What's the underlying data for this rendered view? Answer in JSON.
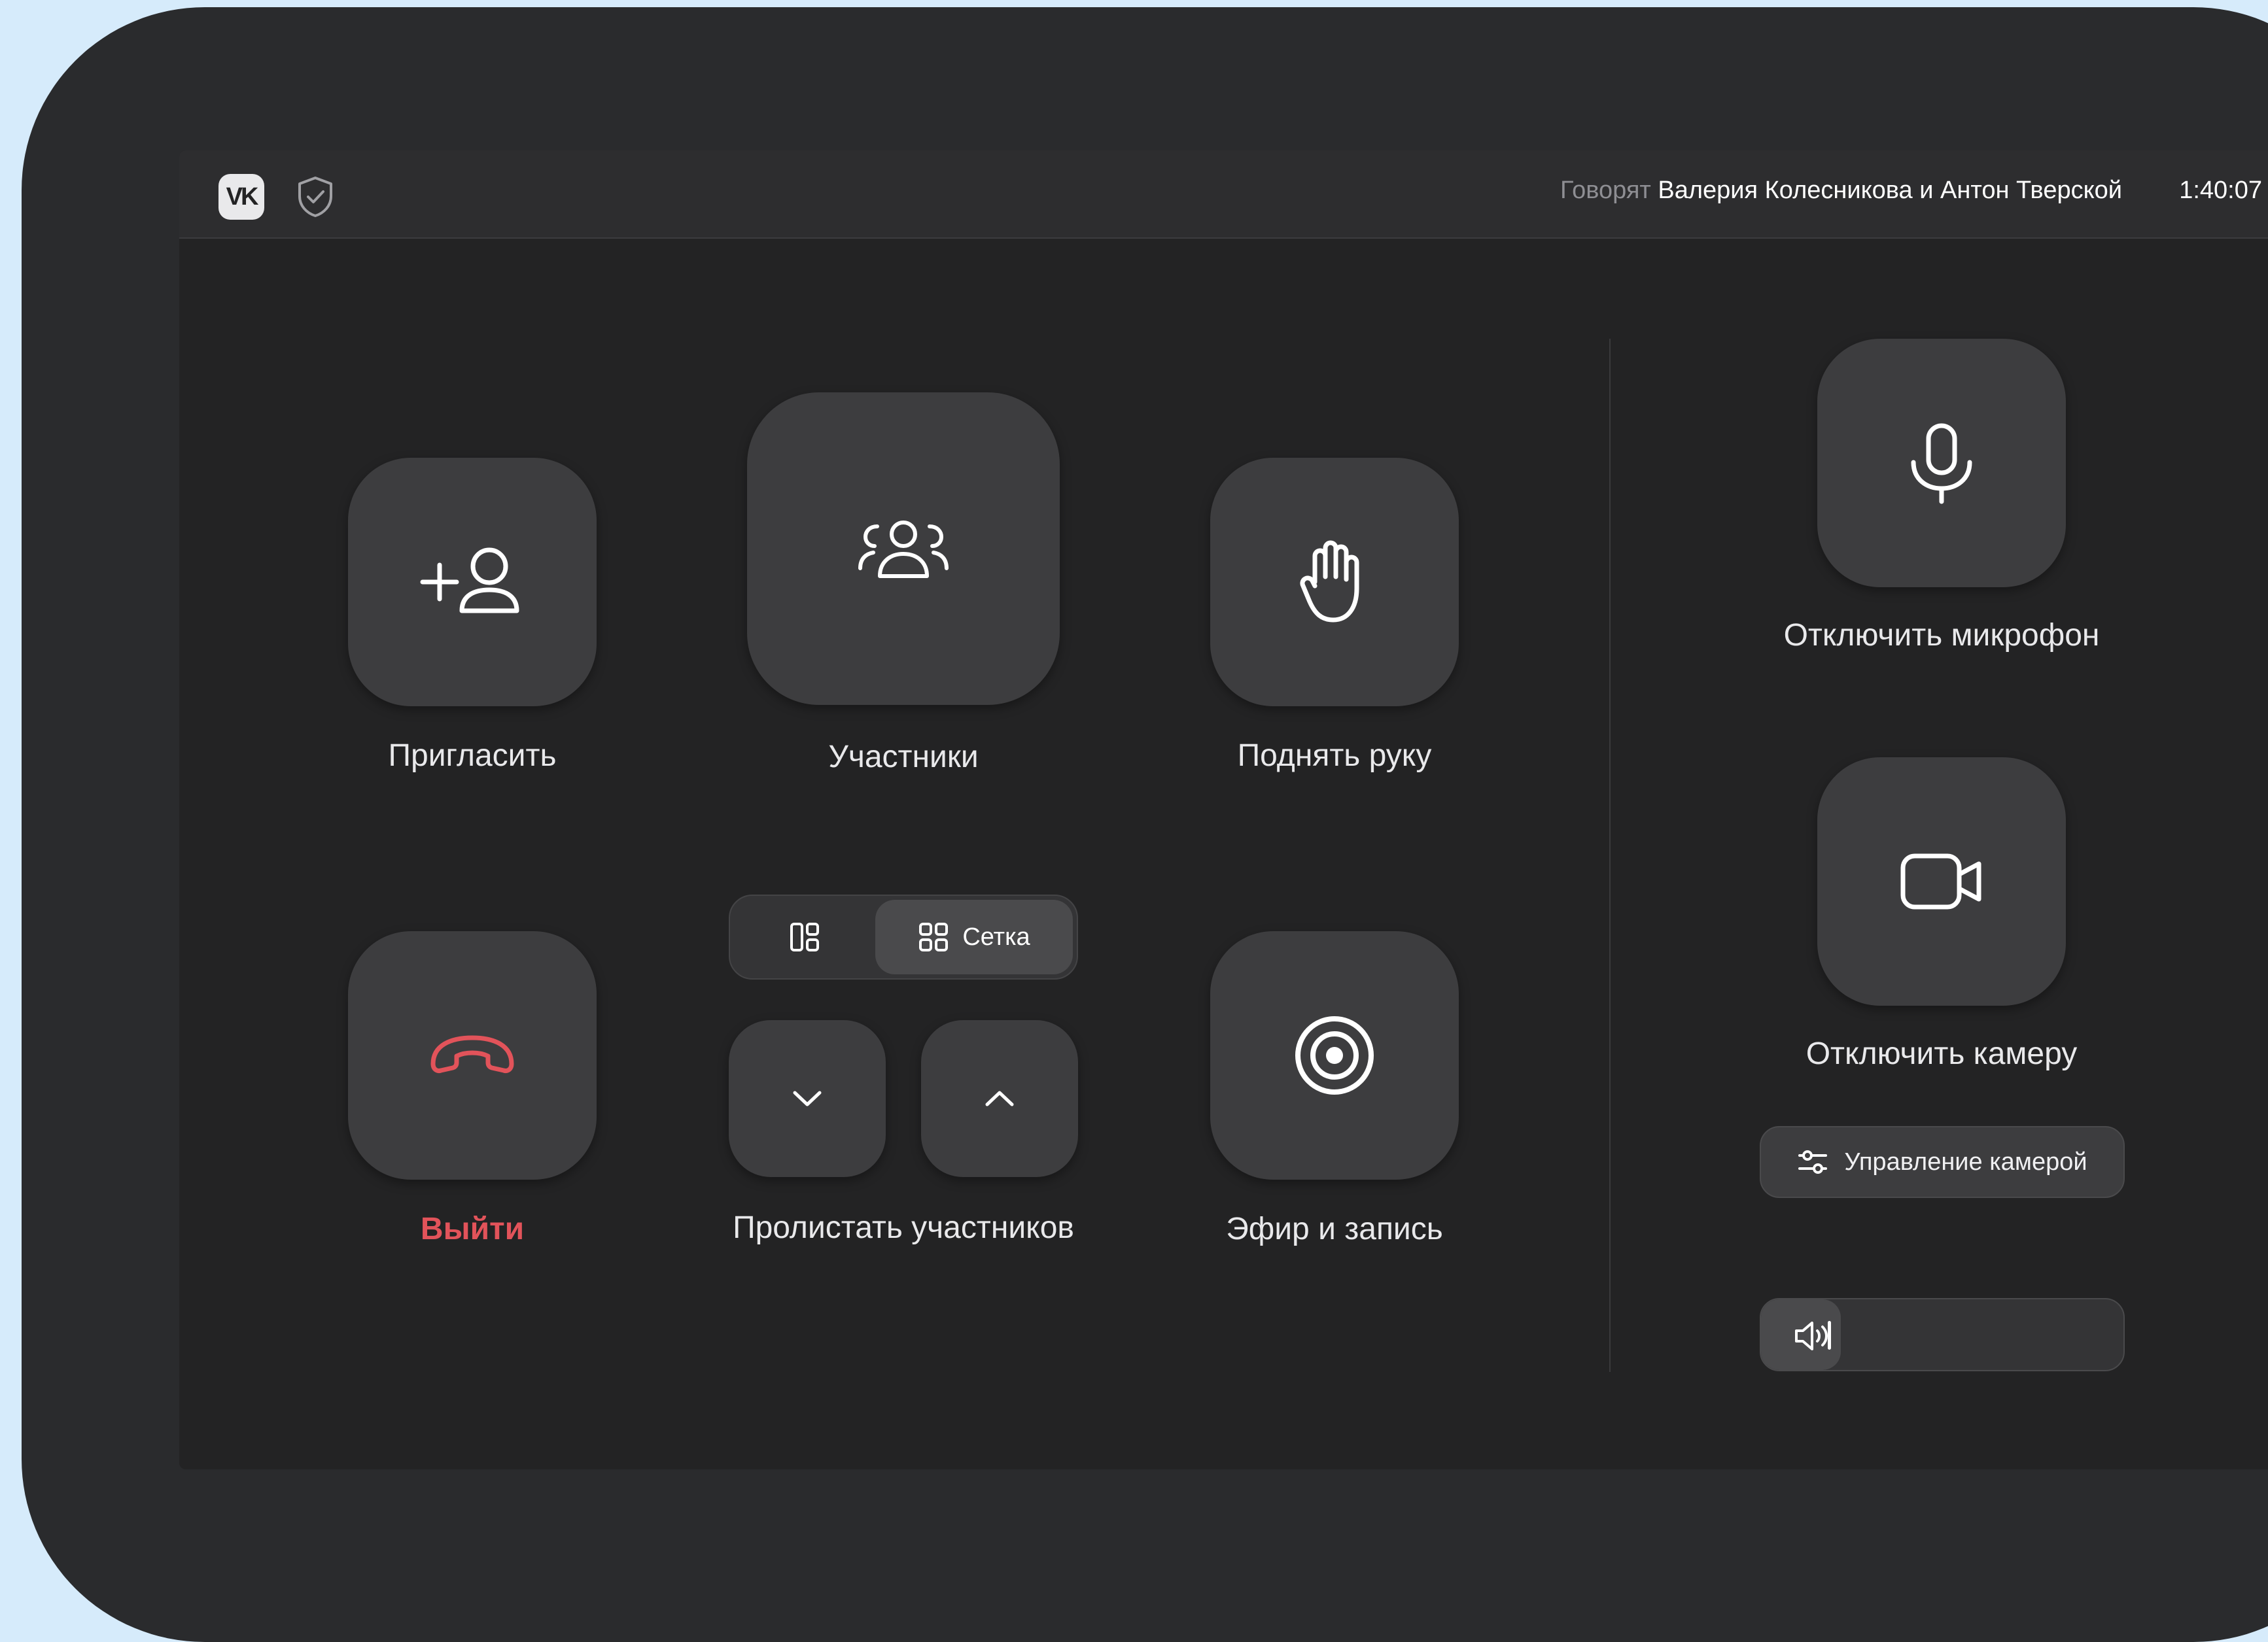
{
  "header": {
    "speaking_prefix": "Говорят",
    "speaking_names": "Валерия Колесникова и Антон Тверской",
    "duration": "1:40:07"
  },
  "icons": {
    "logo": "vk-logo",
    "security": "shield-check-icon",
    "signal": "signal-bars-icon"
  },
  "controls": {
    "invite": "Пригласить",
    "participants": "Участники",
    "raise_hand": "Поднять руку",
    "leave": "Выйти",
    "scroll_participants": "Пролистать участников",
    "broadcast_record": "Эфир и запись",
    "layout_switch": {
      "grid_label": "Сетка",
      "active": "grid"
    }
  },
  "side": {
    "mute_mic": "Отключить микрофон",
    "disable_camera": "Отключить камеру",
    "camera_control": "Управление камерой",
    "volume_level": 0.22
  },
  "colors": {
    "danger": "#e2535a",
    "tile": "#3d3d3f",
    "background": "#232324"
  }
}
